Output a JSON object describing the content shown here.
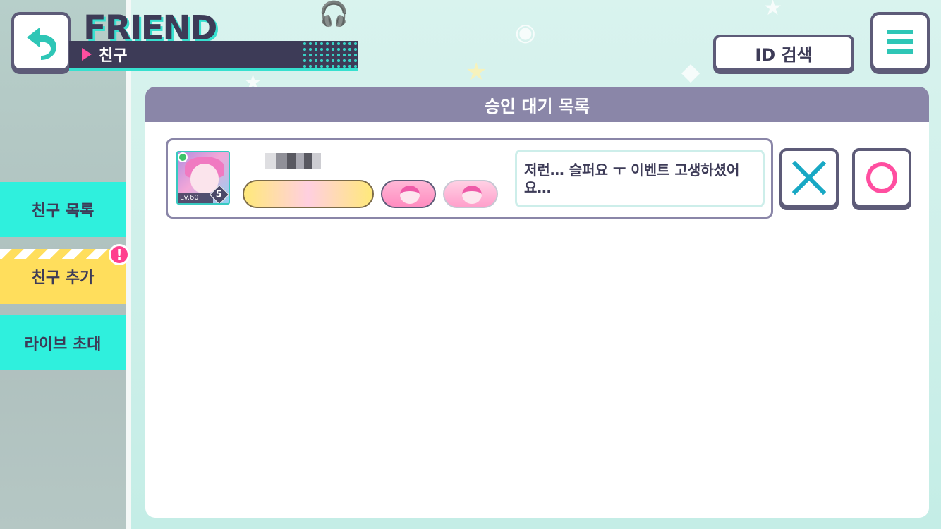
{
  "header": {
    "title_en": "FRIEND",
    "title_ko": "친구",
    "back_icon": "back-arrow-icon",
    "id_search_label": "ID 검색",
    "menu_icon": "hamburger-icon"
  },
  "sidebar": {
    "items": [
      {
        "label": "친구 목록",
        "color": "#2ff0dd"
      },
      {
        "label": "친구 추가",
        "color": "#ffde5c",
        "active": true,
        "alert": "!"
      },
      {
        "label": "라이브 초대",
        "color": "#2ff0dd"
      }
    ]
  },
  "panel": {
    "title": "승인 대기 목록",
    "requests": [
      {
        "level": "Lv.60",
        "rank": "5",
        "message": "저런… 슬퍼요 ㅜ 이벤트 고생하셨어요…",
        "reject_icon": "cross-icon",
        "accept_icon": "circle-icon"
      }
    ]
  },
  "colors": {
    "accent_teal": "#2ec6b6",
    "accent_pink": "#ff4ea0",
    "frame": "#5d5b78",
    "panel_header": "#8a86a8"
  }
}
